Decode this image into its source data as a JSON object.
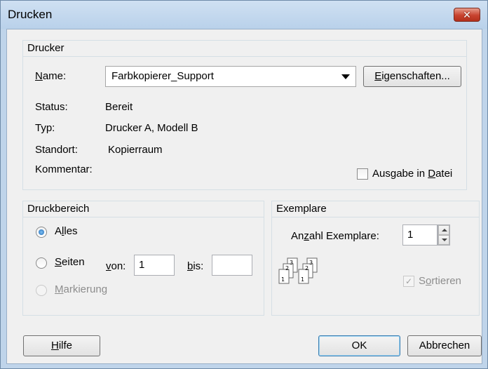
{
  "window": {
    "title": "Drucken",
    "close_glyph": "✕"
  },
  "printer_group": {
    "header": "Drucker",
    "name_label": "Name:",
    "name_value": "Farbkopierer_Support",
    "properties_label": "Eigenschaften...",
    "status_label": "Status:",
    "status_value": "Bereit",
    "type_label": "Typ:",
    "type_value": "Drucker A, Modell B",
    "location_label": "Standort:",
    "location_value": "Kopierraum",
    "comment_label": "Kommentar:",
    "print_to_file_label": "Ausgabe in Datei",
    "print_to_file_checked": false
  },
  "range_group": {
    "header": "Druckbereich",
    "all_label": "Alles",
    "pages_label": "Seiten",
    "from_label": "von:",
    "from_value": "1",
    "to_label": "bis:",
    "to_value": "",
    "selection_label": "Markierung",
    "selected": "all"
  },
  "copies_group": {
    "header": "Exemplare",
    "count_label": "Anzahl Exemplare:",
    "count_value": "1",
    "collate_label": "Sortieren",
    "collate_checked": true,
    "collate_check_glyph": "✓",
    "collate_sheets": [
      "1",
      "2",
      "3"
    ]
  },
  "buttons": {
    "help": "Hilfe",
    "ok": "OK",
    "cancel": "Abbrechen"
  },
  "colors": {
    "title_bar": "#bfd4ea",
    "dialog_bg": "#f0f0f0",
    "close_button": "#c8432f",
    "radio_fill": "#1f69b5"
  }
}
